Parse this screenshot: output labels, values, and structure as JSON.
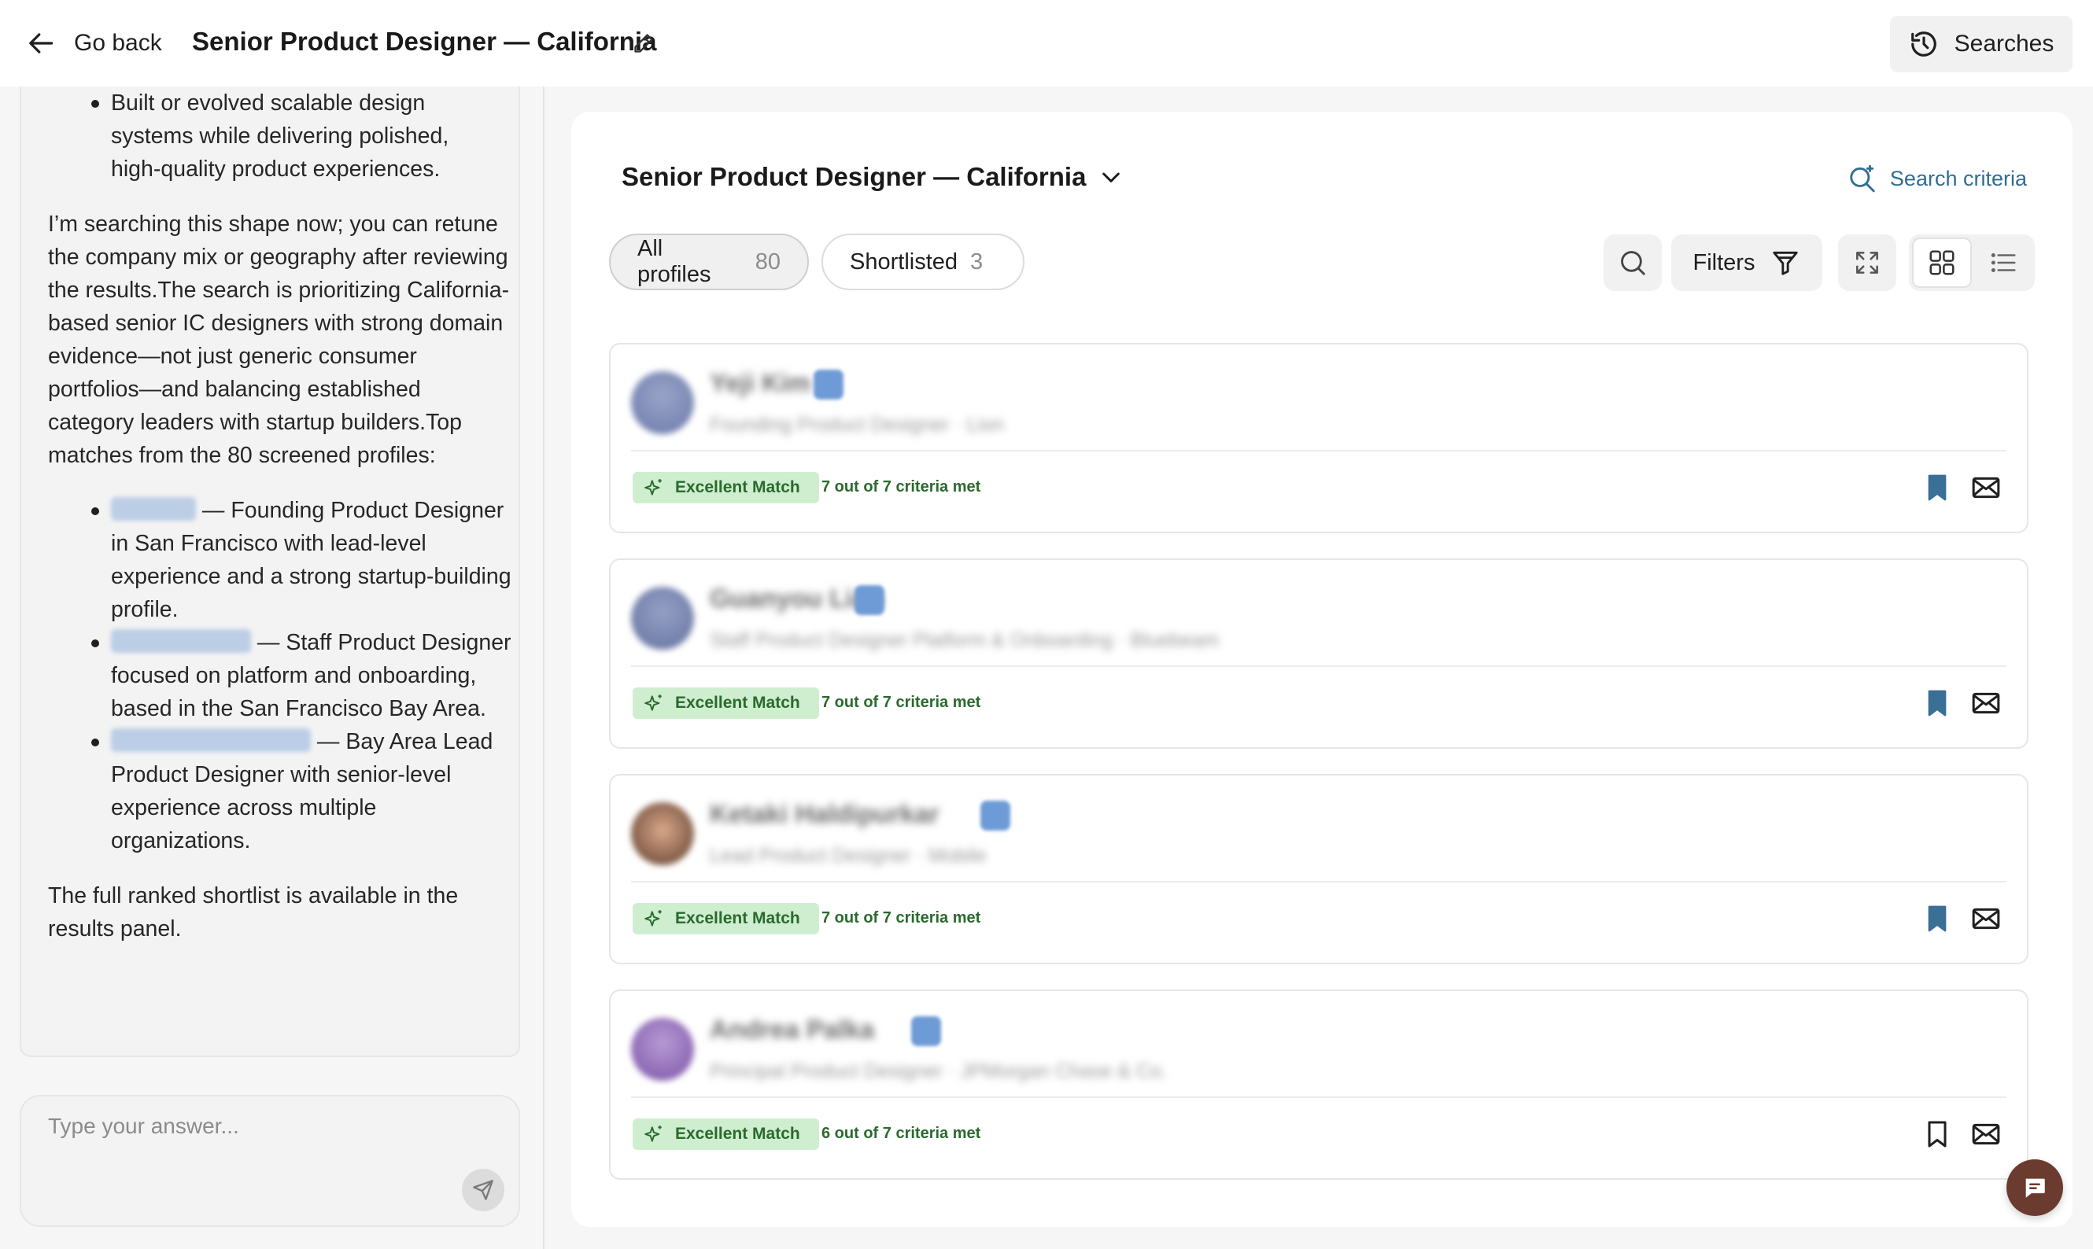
{
  "header": {
    "back_label": "Go back",
    "title": "Senior Product Designer — California",
    "searches_label": "Searches"
  },
  "chat": {
    "top_bullet": "Built or evolved scalable design systems while delivering polished, high-quality product experiences.",
    "paragraph": "I’m searching this shape now; you can retune the company mix or geography after reviewing the results.The search is prioritizing California-based senior IC designers with strong domain evidence—not just generic consumer portfolios—and balancing established category leaders with startup builders.Top matches from the 80 screened profiles:",
    "matches": [
      {
        "text": " — Founding Product Designer in San Francisco with lead-level experience and a strong startup-building profile."
      },
      {
        "text": " — Staff Product Designer focused on platform and onboarding, based in the San Francisco Bay Area."
      },
      {
        "text": " — Bay Area Lead Product Designer with senior-level experience across multiple organizations."
      }
    ],
    "closing": "The full ranked shortlist is available in the results panel.",
    "input_placeholder": "Type your answer..."
  },
  "results": {
    "title": "Senior Product Designer — California",
    "search_criteria_label": "Search criteria",
    "tabs": [
      {
        "label": "All profiles",
        "count": "80"
      },
      {
        "label": "Shortlisted",
        "count": "3"
      }
    ],
    "filters_label": "Filters",
    "profiles": [
      {
        "name": "Yeji Kim",
        "subtitle": "Founding Product Designer · Lion",
        "match": "Excellent Match",
        "criteria": "7 out of 7 criteria met",
        "bookmarked": true
      },
      {
        "name": "Guanyou Lian",
        "subtitle": "Staff Product Designer Platform & Onboarding · Bluebeam",
        "match": "Excellent Match",
        "criteria": "7 out of 7 criteria met",
        "bookmarked": true
      },
      {
        "name": "Ketaki Haldipurkar",
        "subtitle": "Lead Product Designer · Mobile",
        "match": "Excellent Match",
        "criteria": "7 out of 7 criteria met",
        "bookmarked": true
      },
      {
        "name": "Andrea Palka",
        "subtitle": "Principal Product Designer · JPMorgan Chase & Co.",
        "match": "Excellent Match",
        "criteria": "6 out of 7 criteria met",
        "bookmarked": false
      }
    ]
  },
  "colors": {
    "accent": "#2f6d93",
    "bookmark": "#3a6f96",
    "match_bg": "#cfeecf",
    "match_text": "#2a6a2e",
    "fab": "#6b3b2f"
  },
  "icons": [
    "arrow-left-icon",
    "pencil-icon",
    "history-icon",
    "chevron-down-icon",
    "search-sparkle-icon",
    "search-icon",
    "filter-icon",
    "expand-icon",
    "grid-icon",
    "list-icon",
    "sparkle-icon",
    "bookmark-icon",
    "mail-icon",
    "send-icon",
    "chat-icon"
  ]
}
